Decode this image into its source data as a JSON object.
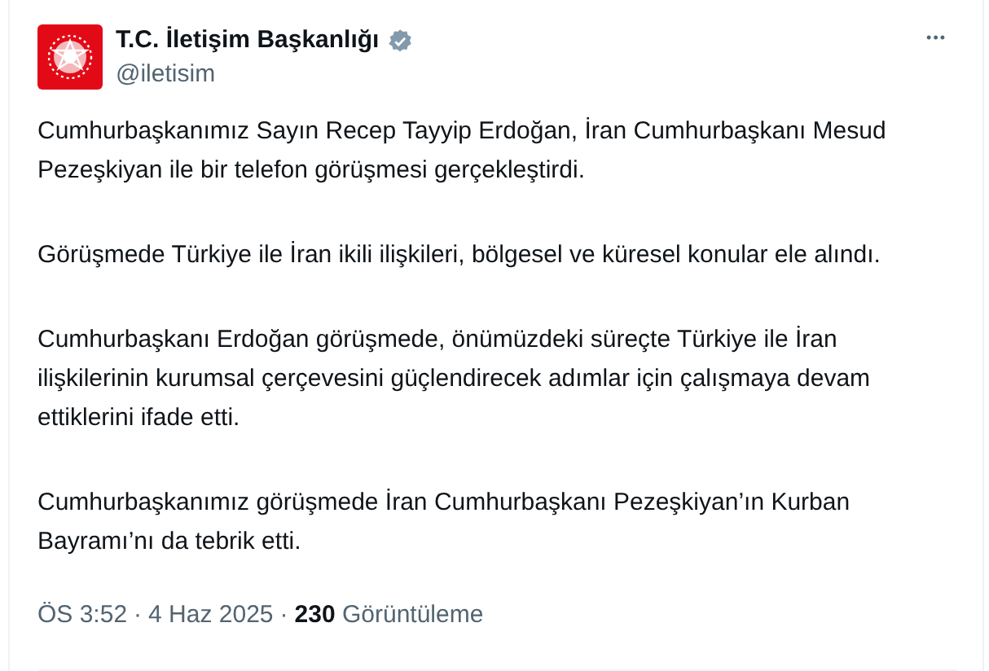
{
  "author": {
    "name": "T.C. İletişim Başkanlığı",
    "verified": true,
    "handle": "@iletisim"
  },
  "menu": "•••",
  "paragraphs": [
    "Cumhurbaşkanımız Sayın Recep Tayyip Erdoğan, İran Cumhurbaşkanı Mesud Pezeşkiyan ile bir telefon görüşmesi gerçekleştirdi.",
    "Görüşmede Türkiye ile İran ikili ilişkileri, bölgesel ve küresel konular ele alındı.",
    "Cumhurbaşkanı Erdoğan görüşmede, önümüzdeki süreçte Türkiye ile İran ilişkilerinin kurumsal çerçevesini güçlendirecek adımlar için çalışmaya devam ettiklerini ifade etti.",
    "Cumhurbaşkanımız görüşmede İran Cumhurbaşkanı Pezeşkiyan’ın Kurban Bayramı’nı da tebrik etti."
  ],
  "footer": {
    "time": "ÖS 3:52",
    "separator_1": "·",
    "date": "4 Haz 2025",
    "separator_2": "·",
    "views": "**230** Görüntüleme"
  }
}
